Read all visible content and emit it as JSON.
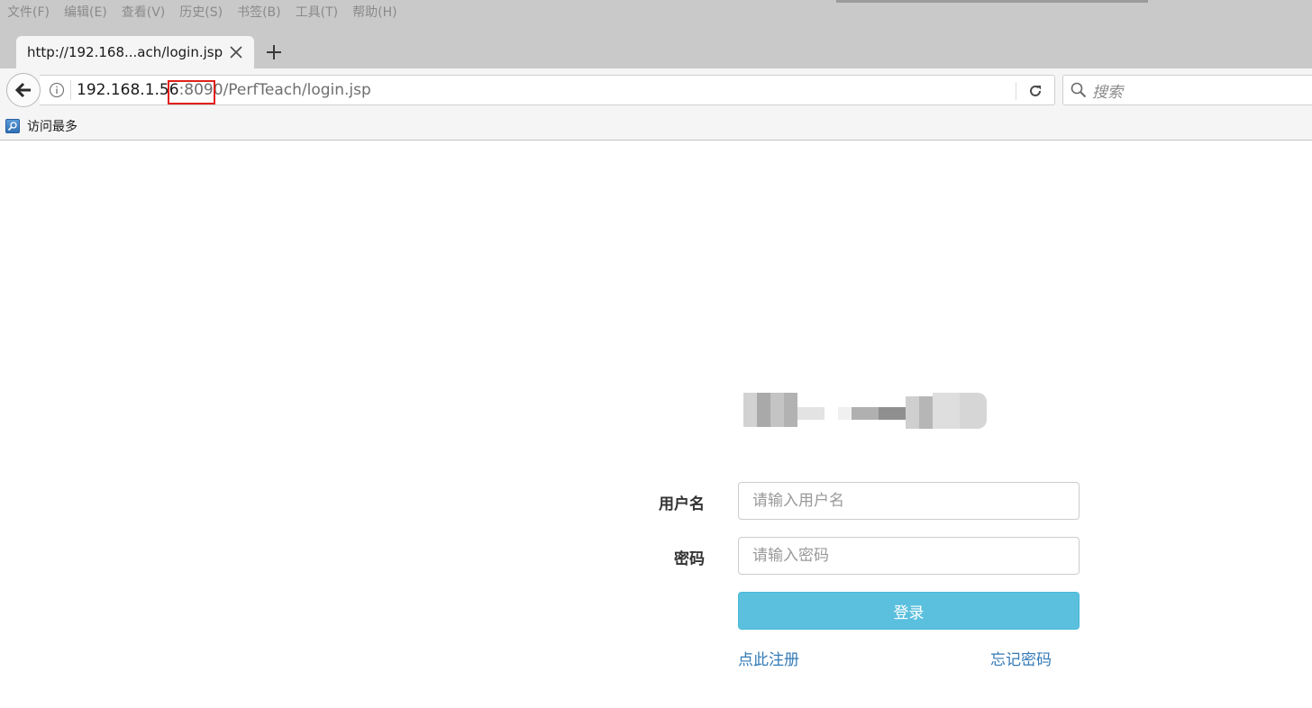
{
  "menubar": {
    "items": [
      "文件(F)",
      "编辑(E)",
      "查看(V)",
      "历史(S)",
      "书签(B)",
      "工具(T)",
      "帮助(H)"
    ]
  },
  "tab": {
    "title": "http://192.168...ach/login.jsp"
  },
  "urlbar": {
    "host": "192.168.1.56",
    "port": ":8090",
    "path": "/PerfTeach/login.jsp"
  },
  "search": {
    "placeholder": "搜索"
  },
  "bookmarks": {
    "items": [
      {
        "label": "访问最多"
      }
    ]
  },
  "login": {
    "username_label": "用户名",
    "username_placeholder": "请输入用户名",
    "password_label": "密码",
    "password_placeholder": "请输入密码",
    "submit_label": "登录",
    "register_link": "点此注册",
    "forgot_link": "忘记密码"
  },
  "colors": {
    "chrome_bg": "#c9c9c9",
    "toolbar_bg": "#f5f5f5",
    "port_highlight": "#e0201a",
    "button_info": "#5bc0de",
    "link": "#337ab7"
  }
}
